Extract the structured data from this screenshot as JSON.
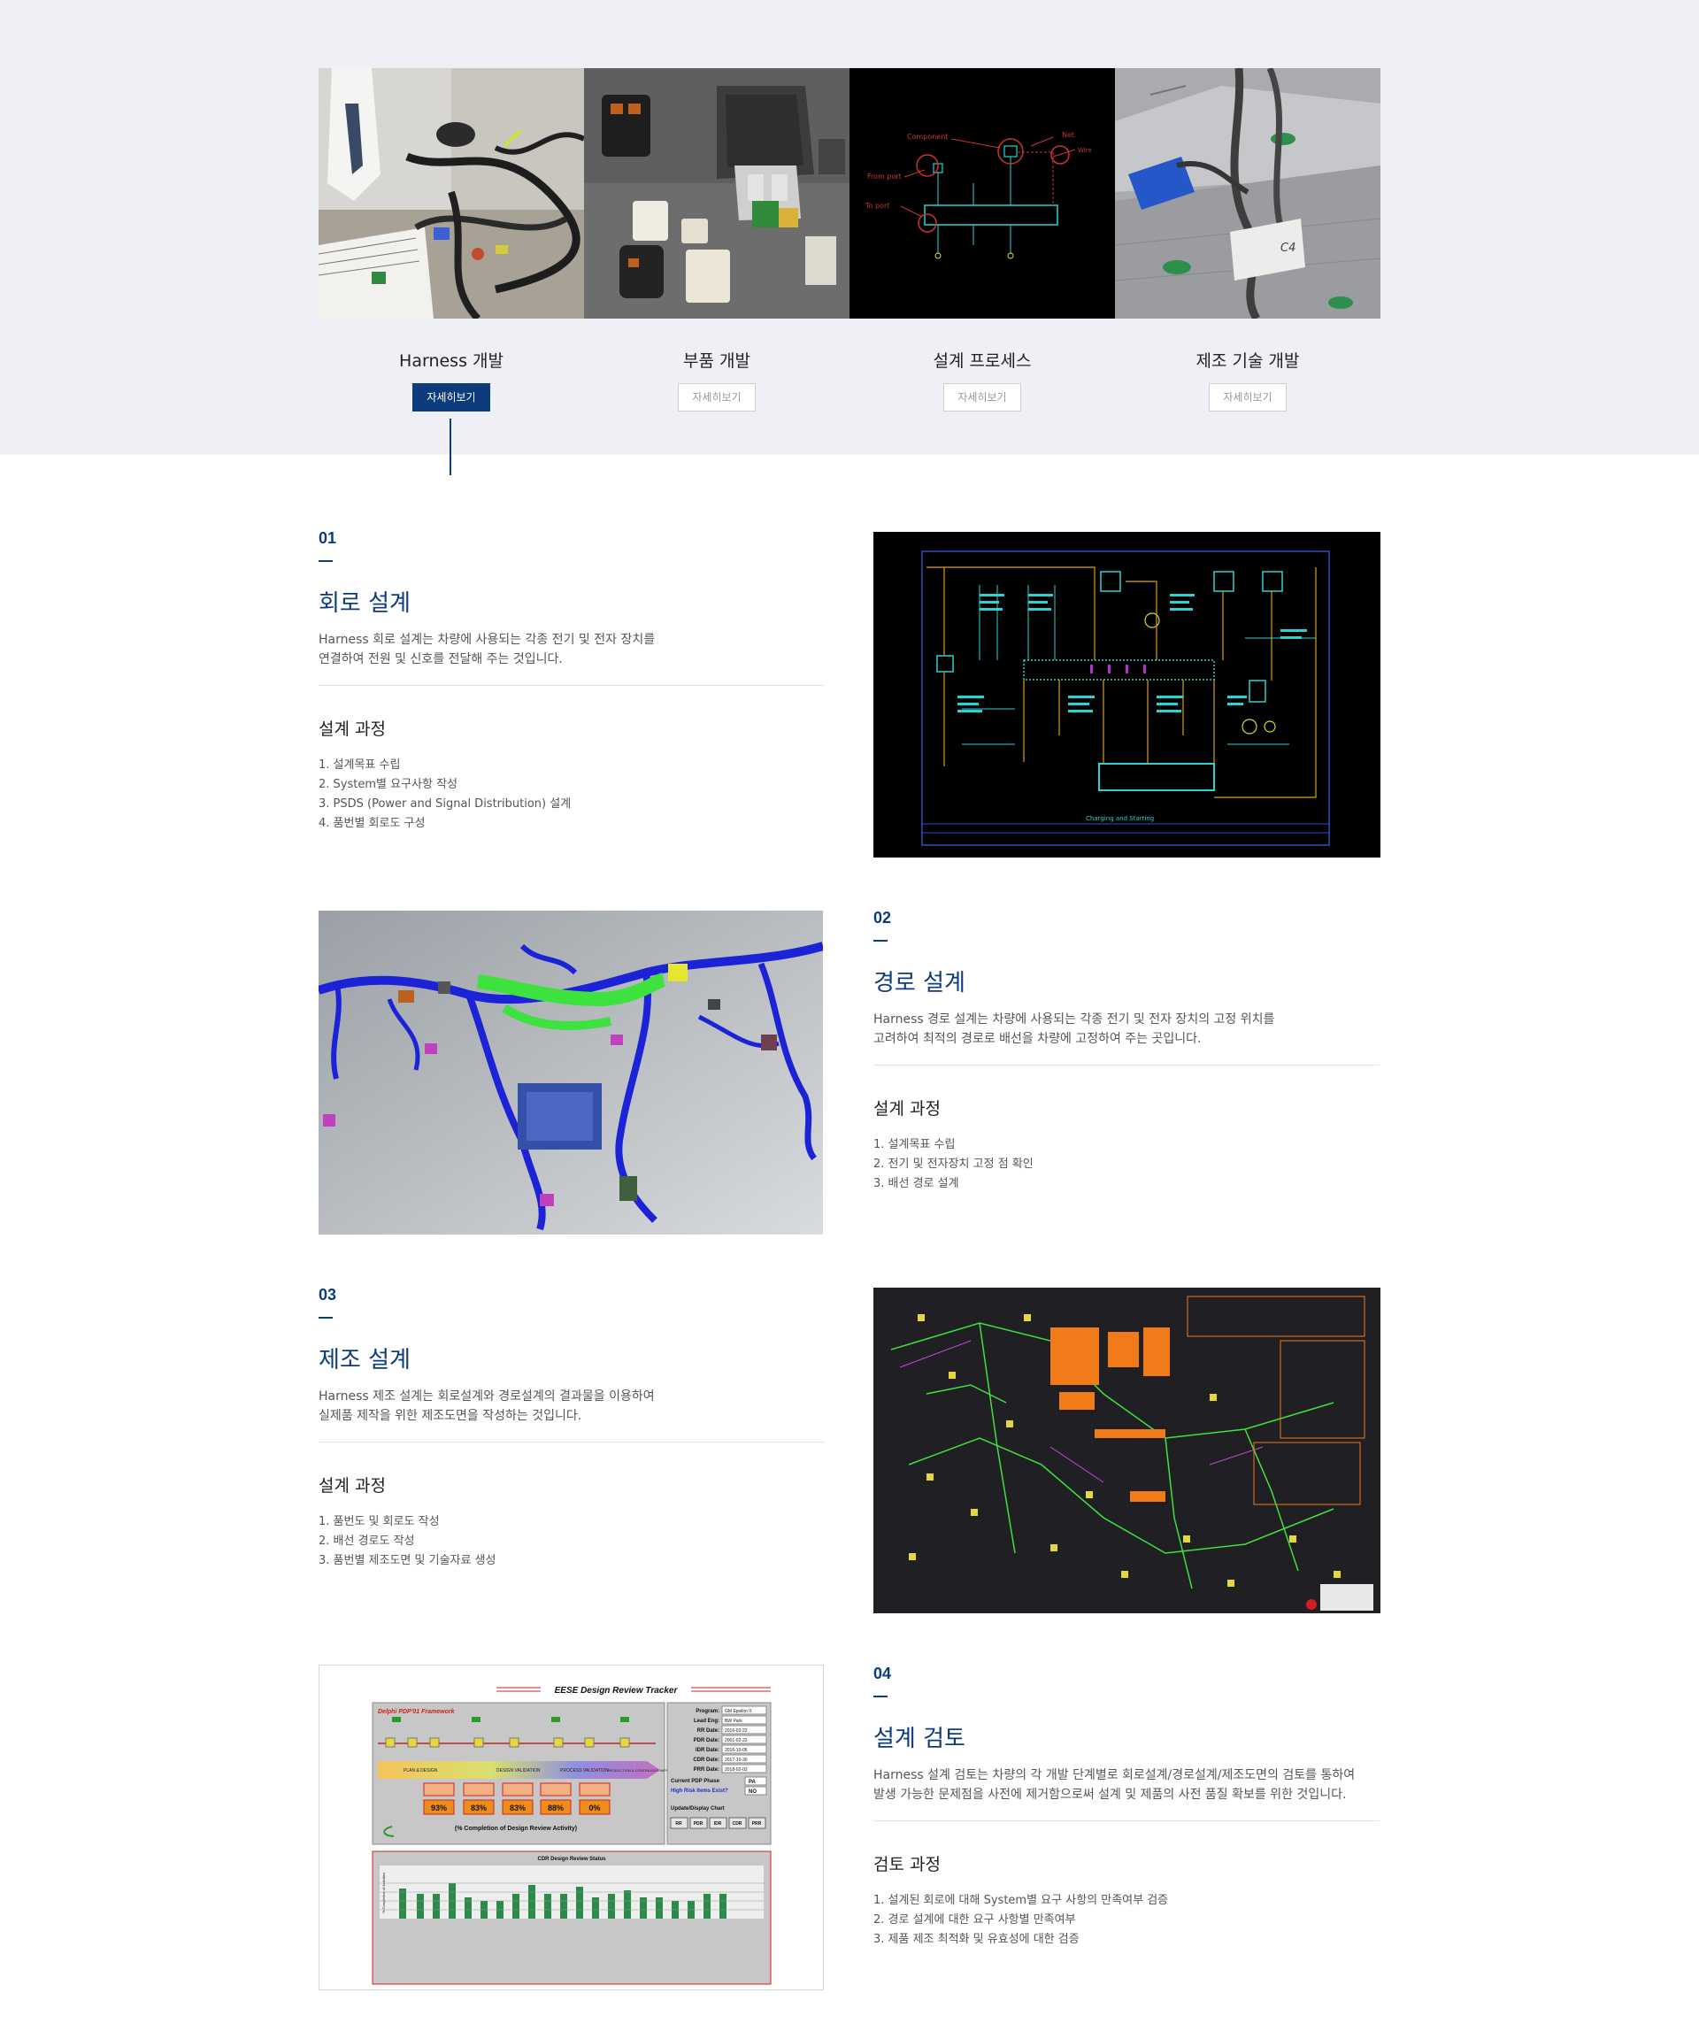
{
  "categories": [
    {
      "title": "Harness 개발",
      "button": "자세히보기",
      "active": true,
      "image": "harness-photo"
    },
    {
      "title": "부품 개발",
      "button": "자세히보기",
      "active": false,
      "image": "connector-parts-photo"
    },
    {
      "title": "설계 프로세스",
      "button": "자세히보기",
      "active": false,
      "image": "process-diagram"
    },
    {
      "title": "제조 기술 개발",
      "button": "자세히보기",
      "active": false,
      "image": "manufacturing-photo"
    }
  ],
  "category_images": {
    "process_labels": [
      "Component",
      "Net",
      "Wire",
      "From port",
      "To port"
    ],
    "manufacturing_tag": "C4"
  },
  "sections": [
    {
      "num": "01",
      "title": "회로 설계",
      "desc": "Harness 회로 설계는 차량에 사용되는 각종 전기 및 전자 장치를\n연결하여 전원 및 신호를 전달해 주는 것입니다.",
      "subtitle": "설계 과정",
      "steps": [
        "1. 설계목표 수립",
        "2. System별 요구사항 작성",
        "3. PSDS (Power and Signal Distribution) 설계",
        "4. 품번별 회로도 구성"
      ],
      "image": "circuit-schematic"
    },
    {
      "num": "02",
      "title": "경로 설계",
      "desc": "Harness 경로 설계는 차량에 사용되는 각종 전기 및 전자 장치의 고정 위치를\n고려하여 최적의 경로로 배선을 차량에 고정하여 주는 곳입니다.",
      "subtitle": "설계 과정",
      "steps": [
        "1. 설계목표 수립",
        "2. 전기 및 전자장치 고정 점 확인",
        "3. 배선 경로 설계"
      ],
      "image": "3d-routing"
    },
    {
      "num": "03",
      "title": "제조 설계",
      "desc": "Harness 제조 설계는 회로설계와 경로설계의 결과물을 이용하여\n실제품 제작을 위한 제조도면을 작성하는 것입니다.",
      "subtitle": "설계 과정",
      "steps": [
        "1. 품번도 및 회로도 작성",
        "2. 배선 경로도 작성",
        "3. 품번별 제조도면 및 기술자료 생성"
      ],
      "image": "manufacturing-drawing"
    },
    {
      "num": "04",
      "title": "설계 검토",
      "desc": "Harness 설계 검토는 차량의 각 개발 단계별로 회로설계/경로설계/제조도면의 검토를 통하여\n발생 가능한 문제점을 사전에 제거함으로써 설계 및 제품의 사전 품질 확보를 위한 것입니다.",
      "subtitle": "검토 과정",
      "steps": [
        "1. 설계된 회로에 대해 System별 요구 사항의 만족여부 검증",
        "2. 경로 설계에 대한 요구 사항별 만족여부",
        "3. 제품 제조 최적화 및 유효성에 대한 검증"
      ],
      "image": "design-review-tracker"
    }
  ],
  "schematic": {
    "caption": "Charging and Starting"
  },
  "tracker": {
    "title": "EESE Design Review Tracker",
    "framework": "Delphi PDP'01\nFramework",
    "phases": [
      "PLAN & DESIGN",
      "DESIGN VALIDATION",
      "PROCESS VALIDATION",
      "PRODUCTION & CONTINUOUS IMPROVEMENT"
    ],
    "percents": [
      "93%",
      "83%",
      "83%",
      "88%",
      "0%"
    ],
    "completion_label": "(% Completion of Design Review Activity)",
    "info": [
      {
        "k": "Program:",
        "v": "GM Epsilon II"
      },
      {
        "k": "Lead Eng:",
        "v": "BW Park"
      },
      {
        "k": "RR Date:",
        "v": "2016-02-22"
      },
      {
        "k": "PDR Date:",
        "v": "2001-02-22"
      },
      {
        "k": "IDR Date:",
        "v": "2016-10-05"
      },
      {
        "k": "CDR Date:",
        "v": "2017-10-30"
      },
      {
        "k": "PRR Date:",
        "v": "2018-02-03"
      }
    ],
    "current_phase_label": "Current PDP Phase",
    "current_phase": "PA",
    "high_risk_label": "High Risk Items Exist?",
    "high_risk": "NO",
    "update_label": "Update/Display Chart",
    "chart_buttons": [
      "RR",
      "PDR",
      "IDR",
      "CDR",
      "PRR"
    ],
    "chart_title": "CDR Design Review Status",
    "chart_ylabel": "% Completion of Activities"
  },
  "colors": {
    "accent": "#0d3c7d",
    "band": "#eff0f5"
  }
}
